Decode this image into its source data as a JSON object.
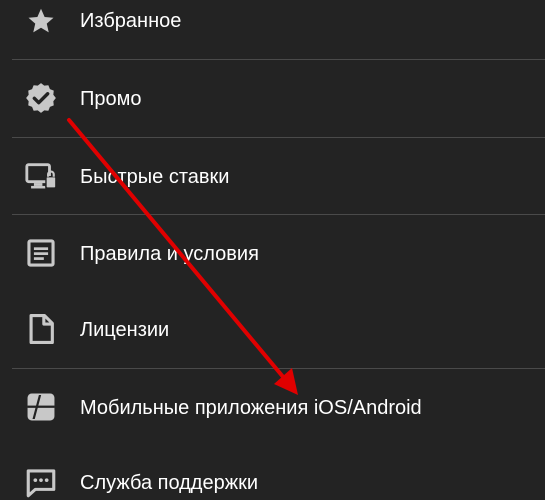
{
  "menu": {
    "items": [
      {
        "label": "Избранное",
        "icon": "star-icon"
      },
      {
        "label": "Промо",
        "icon": "verified-badge-icon"
      },
      {
        "label": "Быстрые ставки",
        "icon": "monitor-lock-icon"
      },
      {
        "label": "Правила и условия",
        "icon": "document-lines-icon"
      },
      {
        "label": "Лицензии",
        "icon": "file-icon"
      },
      {
        "label": "Мобильные приложения iOS/Android",
        "icon": "mobile-app-icon"
      },
      {
        "label": "Служба поддержки",
        "icon": "chat-bubble-icon"
      }
    ]
  },
  "colors": {
    "background": "#232323",
    "icon": "#c8c8c8",
    "text": "#ffffff",
    "divider": "#4a4a4a",
    "annotation_arrow": "#e00000"
  }
}
